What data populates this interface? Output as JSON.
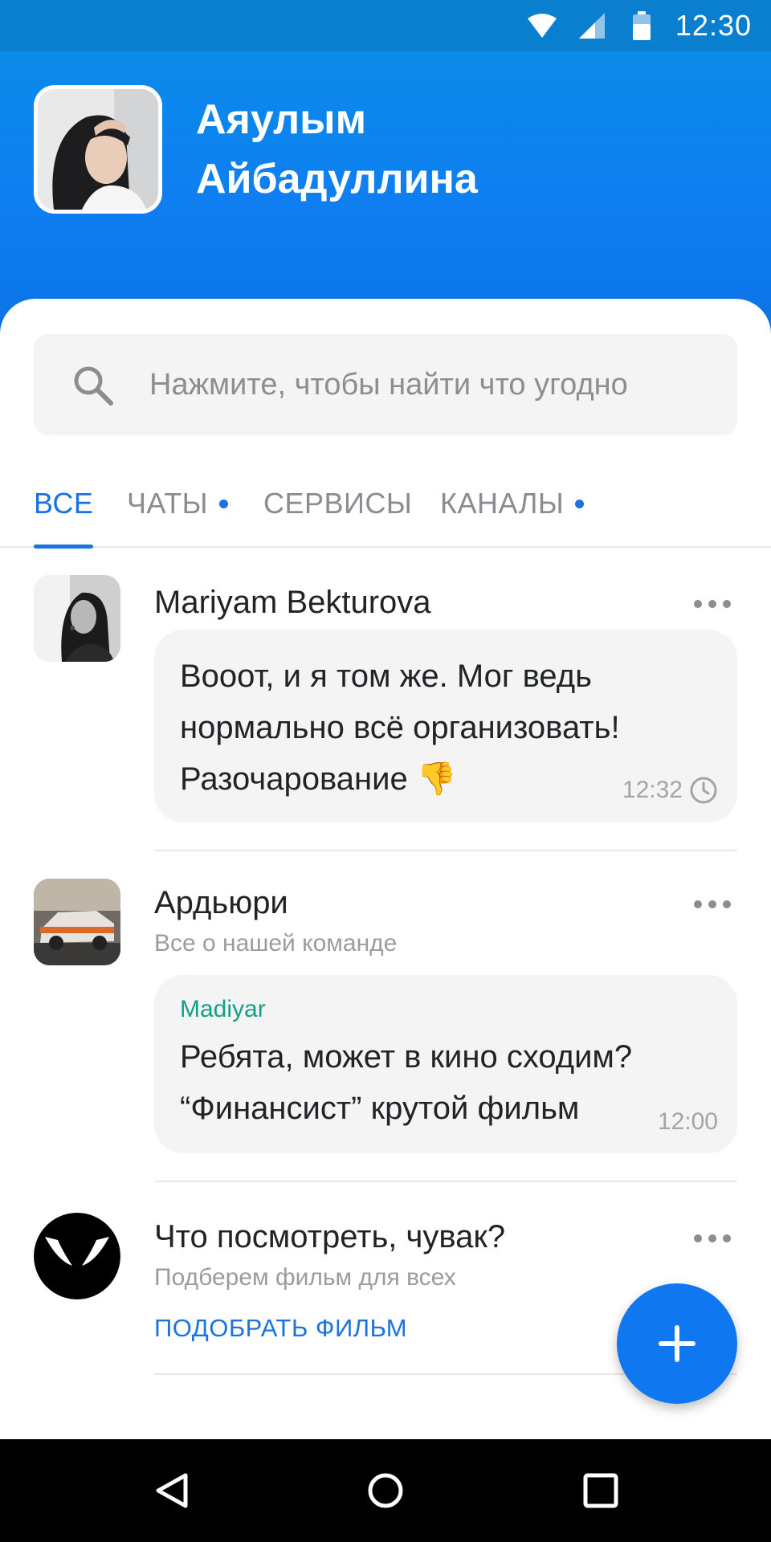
{
  "status_bar": {
    "time": "12:30"
  },
  "profile": {
    "name_line1": "Аяулым",
    "name_line2": "Айбадуллина"
  },
  "search": {
    "placeholder": "Нажмите, чтобы найти что угодно"
  },
  "tabs": [
    {
      "label": "ВСЕ",
      "active": true,
      "dot": false
    },
    {
      "label": "ЧАТЫ",
      "active": false,
      "dot": true
    },
    {
      "label": "СЕРВИСЫ",
      "active": false,
      "dot": false
    },
    {
      "label": "КАНАЛЫ",
      "active": false,
      "dot": true
    }
  ],
  "feed": [
    {
      "title": "Mariyam Bekturova",
      "message_lines": [
        "Вооот, и я том же. Мог ведь",
        "нормально всё организовать!",
        "Разочарование 👎"
      ],
      "time": "12:32"
    },
    {
      "title": "Ардьюри",
      "subtitle": "Все о нашей команде",
      "author": "Madiyar",
      "message_lines": [
        "Ребята, может в кино сходим?",
        "“Финансист” крутой фильм"
      ],
      "time": "12:00"
    },
    {
      "title": "Что посмотреть, чувак?",
      "subtitle": "Подберем фильм для всех",
      "action": "ПОДОБРАТЬ ФИЛЬМ"
    }
  ],
  "colors": {
    "accent": "#1a73e0",
    "header": "#0e7ef0",
    "author": "#13a085"
  },
  "icons": [
    "wifi-icon",
    "signal-icon",
    "battery-icon",
    "search-icon",
    "more-icon",
    "clock-icon",
    "plus-icon",
    "back-icon",
    "home-icon",
    "recents-icon"
  ]
}
